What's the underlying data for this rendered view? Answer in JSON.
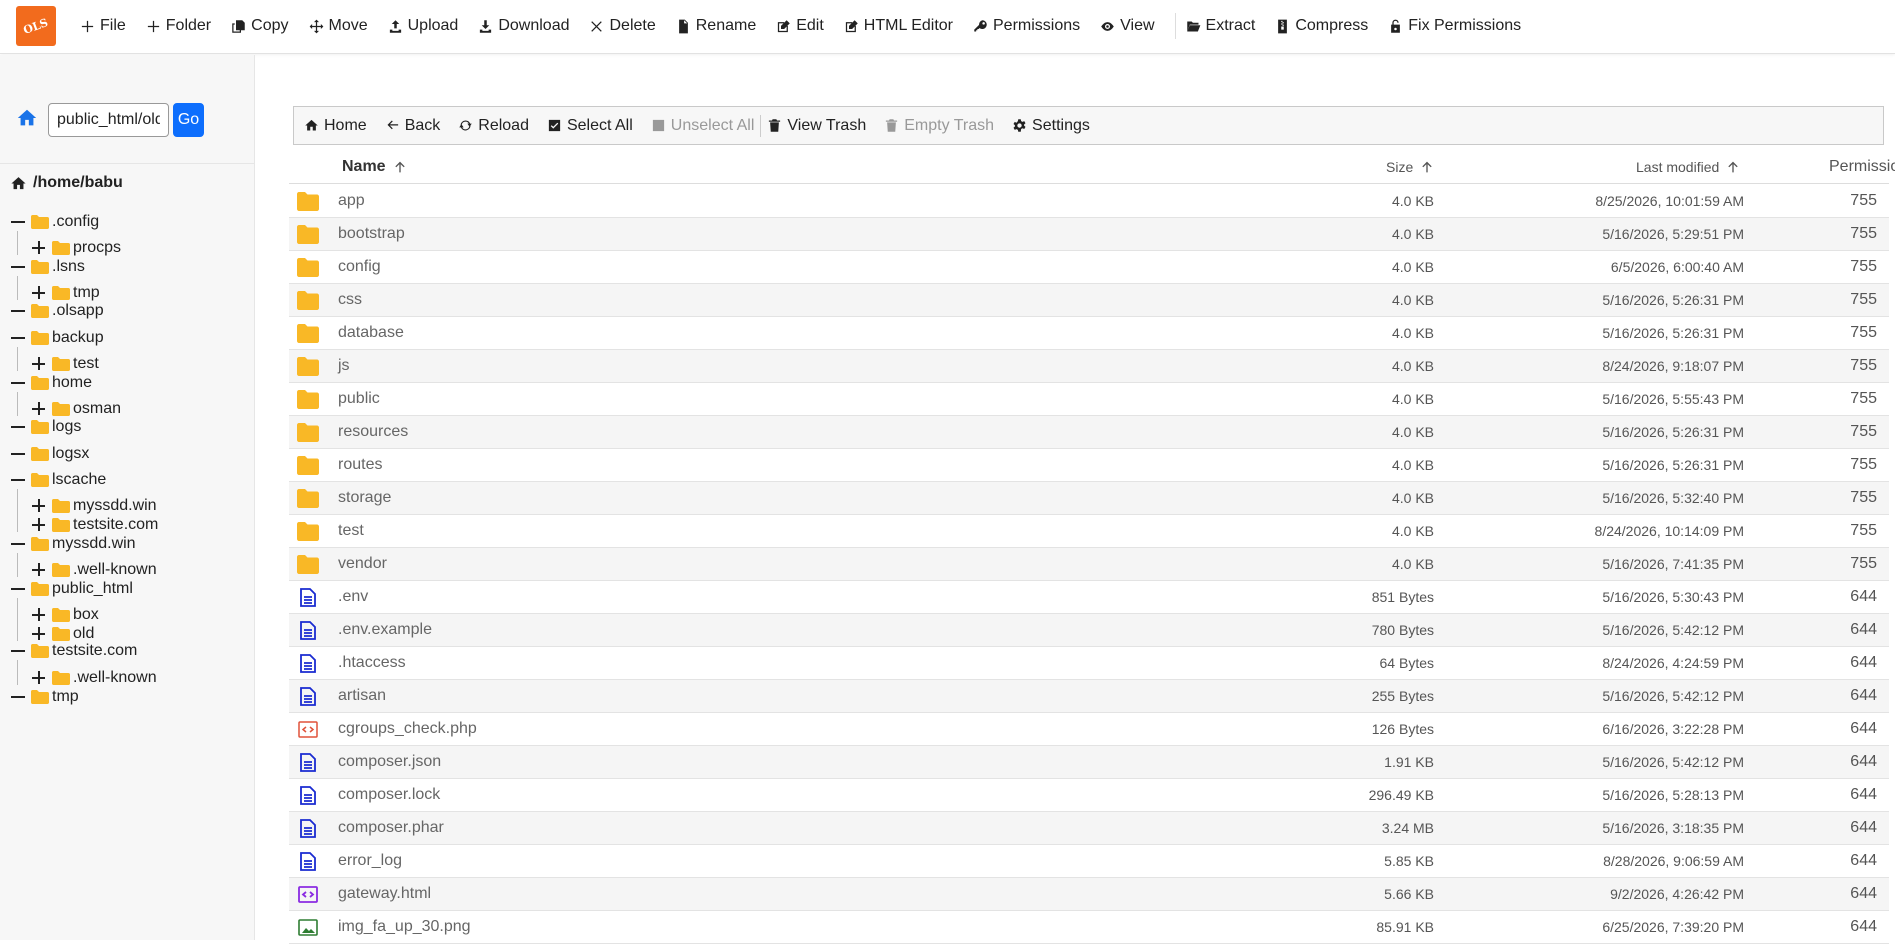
{
  "app": {
    "logo_text": "OLS",
    "brand_color": "#f26b1d"
  },
  "toolbar": [
    {
      "label": "File",
      "icon": "plus-icon"
    },
    {
      "label": "Folder",
      "icon": "plus-icon"
    },
    {
      "label": "Copy",
      "icon": "copy-icon"
    },
    {
      "label": "Move",
      "icon": "move-icon"
    },
    {
      "label": "Upload",
      "icon": "upload-icon"
    },
    {
      "label": "Download",
      "icon": "download-icon"
    },
    {
      "label": "Delete",
      "icon": "times-icon"
    },
    {
      "label": "Rename",
      "icon": "file-icon"
    },
    {
      "label": "Edit",
      "icon": "edit-icon"
    },
    {
      "label": "HTML Editor",
      "icon": "edit-icon"
    },
    {
      "label": "Permissions",
      "icon": "key-icon"
    },
    {
      "label": "View",
      "icon": "eye-icon"
    },
    {
      "label": "Extract",
      "icon": "folder-open-icon"
    },
    {
      "label": "Compress",
      "icon": "file-archive-icon"
    },
    {
      "label": "Fix Permissions",
      "icon": "unlock-icon"
    }
  ],
  "sidebar": {
    "path_value": "public_html/old",
    "go_label": "Go",
    "root_label": "/home/babu",
    "tree": [
      {
        "label": ".config",
        "level": 0,
        "toggle": "minus"
      },
      {
        "label": "procps",
        "level": 1,
        "toggle": "plus"
      },
      {
        "label": ".lsns",
        "level": 0,
        "toggle": "minus"
      },
      {
        "label": "tmp",
        "level": 1,
        "toggle": "plus"
      },
      {
        "label": ".olsapp",
        "level": 0,
        "toggle": "minus"
      },
      {
        "label": "backup",
        "level": 0,
        "toggle": "minus"
      },
      {
        "label": "test",
        "level": 1,
        "toggle": "plus"
      },
      {
        "label": "home",
        "level": 0,
        "toggle": "minus"
      },
      {
        "label": "osman",
        "level": 1,
        "toggle": "plus"
      },
      {
        "label": "logs",
        "level": 0,
        "toggle": "minus"
      },
      {
        "label": "logsx",
        "level": 0,
        "toggle": "minus"
      },
      {
        "label": "lscache",
        "level": 0,
        "toggle": "minus"
      },
      {
        "label": "myssdd.win",
        "level": 1,
        "toggle": "plus"
      },
      {
        "label": "testsite.com",
        "level": 1,
        "toggle": "plus"
      },
      {
        "label": "myssdd.win",
        "level": 0,
        "toggle": "minus"
      },
      {
        "label": ".well-known",
        "level": 1,
        "toggle": "plus"
      },
      {
        "label": "public_html",
        "level": 0,
        "toggle": "minus"
      },
      {
        "label": "box",
        "level": 1,
        "toggle": "plus"
      },
      {
        "label": "old",
        "level": 1,
        "toggle": "plus"
      },
      {
        "label": "testsite.com",
        "level": 0,
        "toggle": "minus"
      },
      {
        "label": ".well-known",
        "level": 1,
        "toggle": "plus"
      },
      {
        "label": "tmp",
        "level": 0,
        "toggle": "minus"
      }
    ]
  },
  "file_toolbar": [
    {
      "label": "Home",
      "icon": "home-icon",
      "disabled": false
    },
    {
      "label": "Back",
      "icon": "arrow-left-icon",
      "disabled": false
    },
    {
      "label": "Reload",
      "icon": "reload-icon",
      "disabled": false
    },
    {
      "label": "Select All",
      "icon": "check-square-icon",
      "disabled": false
    },
    {
      "label": "Unselect All",
      "icon": "square-icon",
      "disabled": true
    },
    {
      "label": "View Trash",
      "icon": "trash-icon",
      "disabled": false
    },
    {
      "label": "Empty Trash",
      "icon": "trash-icon",
      "disabled": true
    },
    {
      "label": "Settings",
      "icon": "gear-icon",
      "disabled": false
    }
  ],
  "table": {
    "headers": {
      "name": "Name",
      "size": "Size",
      "modified": "Last modified",
      "permission": "Permission"
    },
    "rows": [
      {
        "name": "app",
        "type": "folder",
        "size": "4.0 KB",
        "modified": "8/25/2026, 10:01:59 AM",
        "perm": "755"
      },
      {
        "name": "bootstrap",
        "type": "folder",
        "size": "4.0 KB",
        "modified": "5/16/2026, 5:29:51 PM",
        "perm": "755"
      },
      {
        "name": "config",
        "type": "folder",
        "size": "4.0 KB",
        "modified": "6/5/2026, 6:00:40 AM",
        "perm": "755"
      },
      {
        "name": "css",
        "type": "folder",
        "size": "4.0 KB",
        "modified": "5/16/2026, 5:26:31 PM",
        "perm": "755"
      },
      {
        "name": "database",
        "type": "folder",
        "size": "4.0 KB",
        "modified": "5/16/2026, 5:26:31 PM",
        "perm": "755"
      },
      {
        "name": "js",
        "type": "folder",
        "size": "4.0 KB",
        "modified": "8/24/2026, 9:18:07 PM",
        "perm": "755"
      },
      {
        "name": "public",
        "type": "folder",
        "size": "4.0 KB",
        "modified": "5/16/2026, 5:55:43 PM",
        "perm": "755"
      },
      {
        "name": "resources",
        "type": "folder",
        "size": "4.0 KB",
        "modified": "5/16/2026, 5:26:31 PM",
        "perm": "755"
      },
      {
        "name": "routes",
        "type": "folder",
        "size": "4.0 KB",
        "modified": "5/16/2026, 5:26:31 PM",
        "perm": "755"
      },
      {
        "name": "storage",
        "type": "folder",
        "size": "4.0 KB",
        "modified": "5/16/2026, 5:32:40 PM",
        "perm": "755"
      },
      {
        "name": "test",
        "type": "folder",
        "size": "4.0 KB",
        "modified": "8/24/2026, 10:14:09 PM",
        "perm": "755"
      },
      {
        "name": "vendor",
        "type": "folder",
        "size": "4.0 KB",
        "modified": "5/16/2026, 7:41:35 PM",
        "perm": "755"
      },
      {
        "name": ".env",
        "type": "text",
        "size": "851 Bytes",
        "modified": "5/16/2026, 5:30:43 PM",
        "perm": "644"
      },
      {
        "name": ".env.example",
        "type": "text",
        "size": "780 Bytes",
        "modified": "5/16/2026, 5:42:12 PM",
        "perm": "644"
      },
      {
        "name": ".htaccess",
        "type": "text",
        "size": "64 Bytes",
        "modified": "8/24/2026, 4:24:59 PM",
        "perm": "644"
      },
      {
        "name": "artisan",
        "type": "text",
        "size": "255 Bytes",
        "modified": "5/16/2026, 5:42:12 PM",
        "perm": "644"
      },
      {
        "name": "cgroups_check.php",
        "type": "php",
        "size": "126 Bytes",
        "modified": "6/16/2026, 3:22:28 PM",
        "perm": "644"
      },
      {
        "name": "composer.json",
        "type": "text",
        "size": "1.91 KB",
        "modified": "5/16/2026, 5:42:12 PM",
        "perm": "644"
      },
      {
        "name": "composer.lock",
        "type": "text",
        "size": "296.49 KB",
        "modified": "5/16/2026, 5:28:13 PM",
        "perm": "644"
      },
      {
        "name": "composer.phar",
        "type": "text",
        "size": "3.24 MB",
        "modified": "5/16/2026, 3:18:35 PM",
        "perm": "644"
      },
      {
        "name": "error_log",
        "type": "text",
        "size": "5.85 KB",
        "modified": "8/28/2026, 9:06:59 AM",
        "perm": "644"
      },
      {
        "name": "gateway.html",
        "type": "html",
        "size": "5.66 KB",
        "modified": "9/2/2026, 4:26:42 PM",
        "perm": "644"
      },
      {
        "name": "img_fa_up_30.png",
        "type": "image",
        "size": "85.91 KB",
        "modified": "6/25/2026, 7:39:20 PM",
        "perm": "644"
      }
    ]
  },
  "colors": {
    "folder": "#f9b826",
    "text_file": "#1a2bd1",
    "php_file": "#e0523a",
    "html_file": "#8a2be2",
    "image_file": "#2e7d32",
    "go_button": "#0d6efd",
    "home_icon": "#1a73e8"
  }
}
